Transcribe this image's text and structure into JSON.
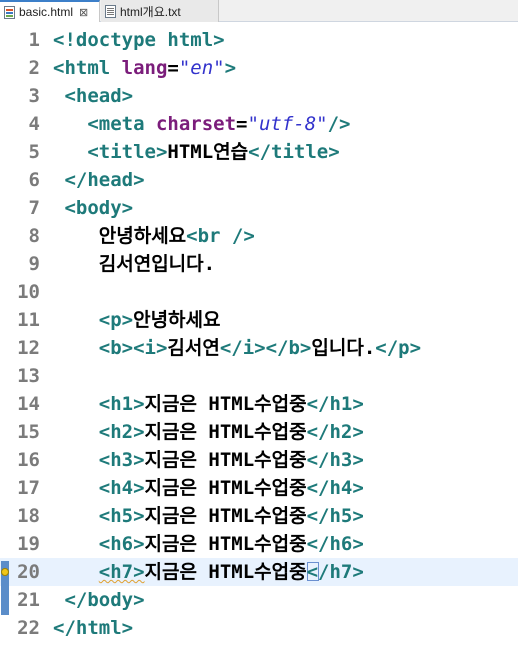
{
  "tabs": [
    {
      "label": "basic.html",
      "close": "⊠",
      "icon": "html-file-icon",
      "active": true
    },
    {
      "label": "html개요.txt",
      "icon": "text-file-icon",
      "active": false
    }
  ],
  "editor": {
    "current_line": 20,
    "lines": [
      {
        "n": "1",
        "tokens": [
          {
            "t": "tg",
            "v": "<!doctype html>"
          }
        ]
      },
      {
        "n": "2",
        "tokens": [
          {
            "t": "tg",
            "v": "<html "
          },
          {
            "t": "at",
            "v": "lang"
          },
          {
            "t": "tx",
            "v": "="
          },
          {
            "t": "vl",
            "v": "\"en\""
          },
          {
            "t": "tg",
            "v": ">"
          }
        ]
      },
      {
        "n": "3",
        "tokens": [
          {
            "t": "tx",
            "v": " "
          },
          {
            "t": "tg",
            "v": "<head>"
          }
        ]
      },
      {
        "n": "4",
        "tokens": [
          {
            "t": "tx",
            "v": "   "
          },
          {
            "t": "tg",
            "v": "<meta "
          },
          {
            "t": "at",
            "v": "charset"
          },
          {
            "t": "tx",
            "v": "="
          },
          {
            "t": "vl",
            "v": "\"utf-8\""
          },
          {
            "t": "tg",
            "v": "/>"
          }
        ]
      },
      {
        "n": "5",
        "tokens": [
          {
            "t": "tx",
            "v": "   "
          },
          {
            "t": "tg",
            "v": "<title>"
          },
          {
            "t": "tx",
            "v": "HTML연습"
          },
          {
            "t": "tg",
            "v": "</title>"
          }
        ]
      },
      {
        "n": "6",
        "tokens": [
          {
            "t": "tx",
            "v": " "
          },
          {
            "t": "tg",
            "v": "</head>"
          }
        ]
      },
      {
        "n": "7",
        "tokens": [
          {
            "t": "tx",
            "v": " "
          },
          {
            "t": "tg",
            "v": "<body>"
          }
        ]
      },
      {
        "n": "8",
        "tokens": [
          {
            "t": "tx",
            "v": "    안녕하세요"
          },
          {
            "t": "tg",
            "v": "<br />"
          }
        ]
      },
      {
        "n": "9",
        "tokens": [
          {
            "t": "tx",
            "v": "    김서연입니다."
          }
        ]
      },
      {
        "n": "10",
        "tokens": []
      },
      {
        "n": "11",
        "tokens": [
          {
            "t": "tx",
            "v": "    "
          },
          {
            "t": "tg",
            "v": "<p>"
          },
          {
            "t": "tx",
            "v": "안녕하세요"
          }
        ]
      },
      {
        "n": "12",
        "tokens": [
          {
            "t": "tx",
            "v": "    "
          },
          {
            "t": "tg",
            "v": "<b><i>"
          },
          {
            "t": "tx",
            "v": "김서연"
          },
          {
            "t": "tg",
            "v": "</i></b>"
          },
          {
            "t": "tx",
            "v": "입니다."
          },
          {
            "t": "tg",
            "v": "</p>"
          }
        ]
      },
      {
        "n": "13",
        "tokens": []
      },
      {
        "n": "14",
        "tokens": [
          {
            "t": "tx",
            "v": "    "
          },
          {
            "t": "tg",
            "v": "<h1>"
          },
          {
            "t": "tx",
            "v": "지금은 HTML수업중"
          },
          {
            "t": "tg",
            "v": "</h1>"
          }
        ]
      },
      {
        "n": "15",
        "tokens": [
          {
            "t": "tx",
            "v": "    "
          },
          {
            "t": "tg",
            "v": "<h2>"
          },
          {
            "t": "tx",
            "v": "지금은 HTML수업중"
          },
          {
            "t": "tg",
            "v": "</h2>"
          }
        ]
      },
      {
        "n": "16",
        "tokens": [
          {
            "t": "tx",
            "v": "    "
          },
          {
            "t": "tg",
            "v": "<h3>"
          },
          {
            "t": "tx",
            "v": "지금은 HTML수업중"
          },
          {
            "t": "tg",
            "v": "</h3>"
          }
        ]
      },
      {
        "n": "17",
        "tokens": [
          {
            "t": "tx",
            "v": "    "
          },
          {
            "t": "tg",
            "v": "<h4>"
          },
          {
            "t": "tx",
            "v": "지금은 HTML수업중"
          },
          {
            "t": "tg",
            "v": "</h4>"
          }
        ]
      },
      {
        "n": "18",
        "tokens": [
          {
            "t": "tx",
            "v": "    "
          },
          {
            "t": "tg",
            "v": "<h5>"
          },
          {
            "t": "tx",
            "v": "지금은 HTML수업중"
          },
          {
            "t": "tg",
            "v": "</h5>"
          }
        ]
      },
      {
        "n": "19",
        "tokens": [
          {
            "t": "tx",
            "v": "    "
          },
          {
            "t": "tg",
            "v": "<h6>"
          },
          {
            "t": "tx",
            "v": "지금은 HTML수업중"
          },
          {
            "t": "tg",
            "v": "</h6>"
          }
        ]
      },
      {
        "n": "20",
        "tokens": [
          {
            "t": "tx",
            "v": "    "
          },
          {
            "t": "tg",
            "v": "<h7>",
            "sq": true
          },
          {
            "t": "tx",
            "v": "지금은 HTML수업중"
          },
          {
            "t": "caret"
          },
          {
            "t": "tg",
            "v": "</h7>"
          }
        ]
      },
      {
        "n": "21",
        "tokens": [
          {
            "t": "tx",
            "v": " "
          },
          {
            "t": "tg",
            "v": "</body>"
          }
        ]
      },
      {
        "n": "22",
        "tokens": [
          {
            "t": "tg",
            "v": "</html>"
          }
        ]
      }
    ]
  },
  "colors": {
    "tag": "#1e7a7a",
    "attribute": "#7b1d7b",
    "value": "#3333cc",
    "current_line": "#e8f2fe"
  }
}
